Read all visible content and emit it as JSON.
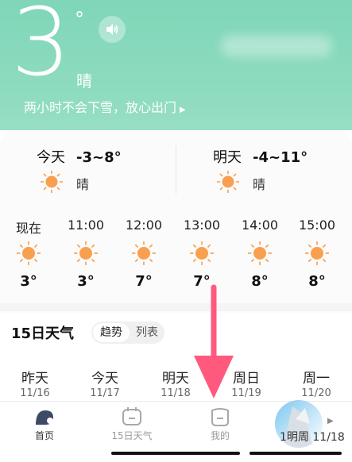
{
  "current": {
    "temp": "3",
    "degree": "°",
    "condition": "晴",
    "alert": "两小时不会下雪，放心出门",
    "alert_arrow": "▶"
  },
  "today": {
    "label": "今天",
    "range": "-3~8°",
    "condition": "晴"
  },
  "tomorrow": {
    "label": "明天",
    "range": "-4~11°",
    "condition": "晴"
  },
  "hourly": [
    {
      "time": "现在",
      "temp": "3°"
    },
    {
      "time": "11:00",
      "temp": "3°"
    },
    {
      "time": "12:00",
      "temp": "7°"
    },
    {
      "time": "13:00",
      "temp": "7°"
    },
    {
      "time": "14:00",
      "temp": "8°"
    },
    {
      "time": "15:00",
      "temp": "8°"
    }
  ],
  "forecast15": {
    "title": "15日天气",
    "tab_trend": "趋势",
    "tab_list": "列表",
    "days": [
      {
        "name": "昨天",
        "date": "11/16"
      },
      {
        "name": "今天",
        "date": "11/17"
      },
      {
        "name": "明天",
        "date": "11/18"
      },
      {
        "name": "周日",
        "date": "11/19"
      },
      {
        "name": "周一",
        "date": "11/20"
      }
    ]
  },
  "nav": {
    "home": "首页",
    "days15": "15日天气",
    "mine": "我的",
    "promo": "1明周",
    "promo_date": "11/18"
  },
  "colors": {
    "hero": "#8fdcc0",
    "sun": "#f8a050",
    "arrow": "#ff5a7d"
  }
}
